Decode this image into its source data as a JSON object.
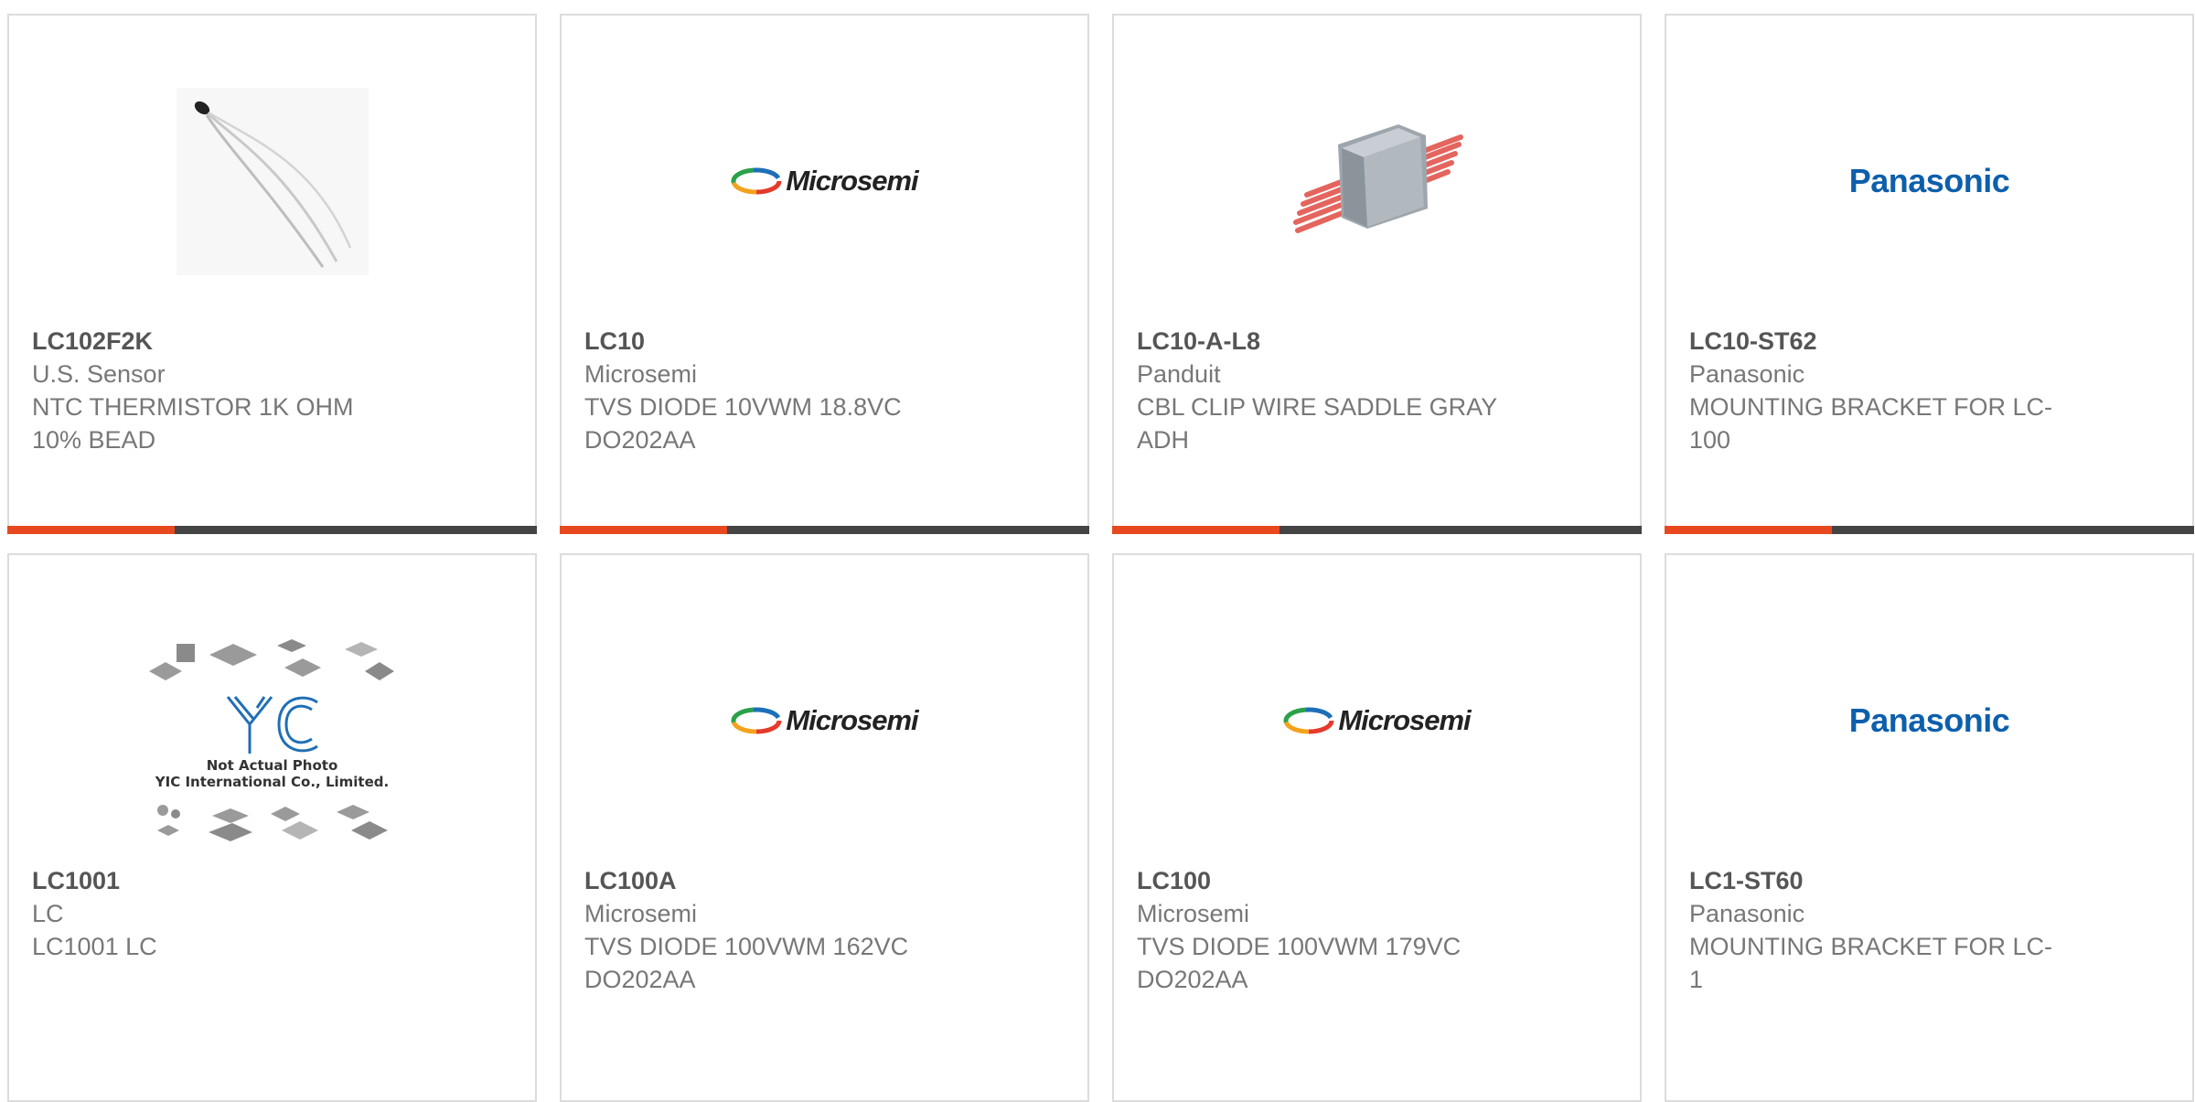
{
  "products": [
    {
      "part": "LC102F2K",
      "manufacturer": "U.S. Sensor",
      "desc1": "NTC THERMISTOR 1K OHM",
      "desc2": "10% BEAD",
      "image": "thermistor-photo"
    },
    {
      "part": "LC10",
      "manufacturer": "Microsemi",
      "desc1": "TVS DIODE 10VWM 18.8VC",
      "desc2": "DO202AA",
      "image": "microsemi-logo",
      "logo_text": "Microsemi"
    },
    {
      "part": "LC10-A-L8",
      "manufacturer": "Panduit",
      "desc1": "CBL CLIP WIRE SADDLE GRAY",
      "desc2": "ADH",
      "image": "cable-clip-photo"
    },
    {
      "part": "LC10-ST62",
      "manufacturer": "Panasonic",
      "desc1": "MOUNTING BRACKET FOR LC-",
      "desc2": "100",
      "image": "panasonic-logo",
      "logo_text": "Panasonic"
    },
    {
      "part": "LC1001",
      "manufacturer": "LC",
      "desc1": "LC1001 LC",
      "desc2": "",
      "image": "placeholder-photo",
      "placeholder_text1": "Not Actual Photo",
      "placeholder_text2": "YIC International Co., Limited."
    },
    {
      "part": "LC100A",
      "manufacturer": "Microsemi",
      "desc1": "TVS DIODE 100VWM 162VC",
      "desc2": "DO202AA",
      "image": "microsemi-logo",
      "logo_text": "Microsemi"
    },
    {
      "part": "LC100",
      "manufacturer": "Microsemi",
      "desc1": "TVS DIODE 100VWM 179VC",
      "desc2": "DO202AA",
      "image": "microsemi-logo",
      "logo_text": "Microsemi"
    },
    {
      "part": "LC1-ST60",
      "manufacturer": "Panasonic",
      "desc1": "MOUNTING BRACKET FOR LC-",
      "desc2": "1",
      "image": "panasonic-logo",
      "logo_text": "Panasonic"
    }
  ],
  "colors": {
    "accent": "#e8481e",
    "bar": "#444444",
    "panasonic_blue": "#0d5fac",
    "border": "#dcdcdc"
  }
}
